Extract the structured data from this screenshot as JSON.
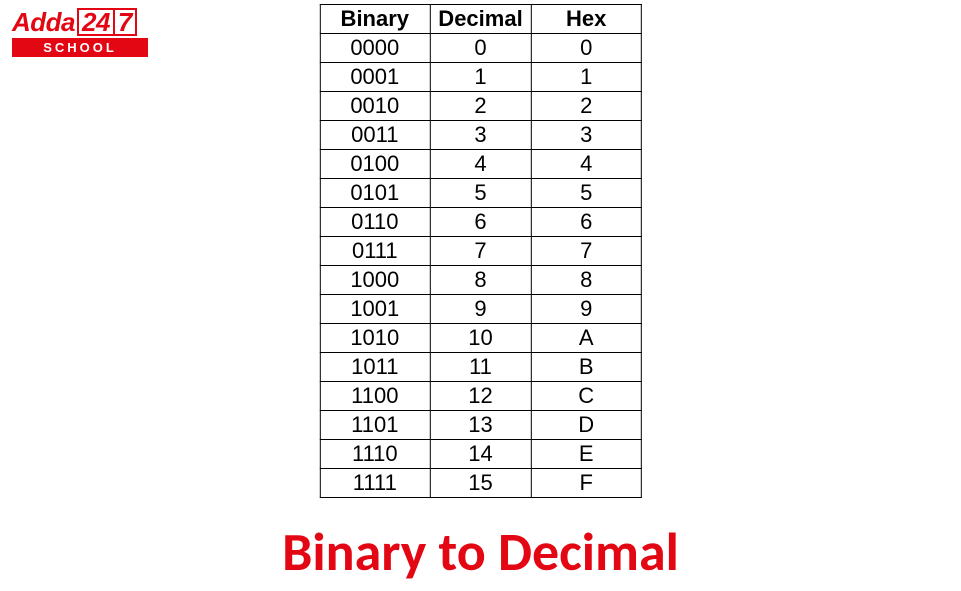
{
  "logo": {
    "brand": "Adda",
    "num_left": "24",
    "num_right": "7",
    "sub": "SCHOOL"
  },
  "table": {
    "headers": {
      "binary": "Binary",
      "decimal": "Decimal",
      "hex": "Hex"
    }
  },
  "chart_data": {
    "type": "table",
    "title": "Binary to Decimal",
    "columns": [
      "Binary",
      "Decimal",
      "Hex"
    ],
    "rows": [
      {
        "binary": "0000",
        "decimal": "0",
        "hex": "0"
      },
      {
        "binary": "0001",
        "decimal": "1",
        "hex": "1"
      },
      {
        "binary": "0010",
        "decimal": "2",
        "hex": "2"
      },
      {
        "binary": "0011",
        "decimal": "3",
        "hex": "3"
      },
      {
        "binary": "0100",
        "decimal": "4",
        "hex": "4"
      },
      {
        "binary": "0101",
        "decimal": "5",
        "hex": "5"
      },
      {
        "binary": "0110",
        "decimal": "6",
        "hex": "6"
      },
      {
        "binary": "0111",
        "decimal": "7",
        "hex": "7"
      },
      {
        "binary": "1000",
        "decimal": "8",
        "hex": "8"
      },
      {
        "binary": "1001",
        "decimal": "9",
        "hex": "9"
      },
      {
        "binary": "1010",
        "decimal": "10",
        "hex": "A"
      },
      {
        "binary": "1011",
        "decimal": "11",
        "hex": "B"
      },
      {
        "binary": "1100",
        "decimal": "12",
        "hex": "C"
      },
      {
        "binary": "1101",
        "decimal": "13",
        "hex": "D"
      },
      {
        "binary": "1110",
        "decimal": "14",
        "hex": "E"
      },
      {
        "binary": "1111",
        "decimal": "15",
        "hex": "F"
      }
    ]
  },
  "title": "Binary to Decimal"
}
